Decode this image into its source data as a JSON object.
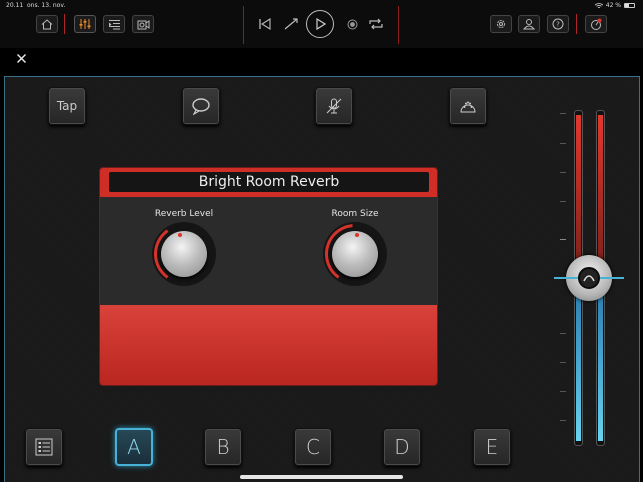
{
  "status": {
    "time": "20.11",
    "date": "ons. 13. nov.",
    "battery": "42 %"
  },
  "toolbar": {
    "left_icons": [
      "home-icon",
      "mixer-icon",
      "list-icon",
      "amp-icon"
    ],
    "transport_icons": [
      "skip-back-icon",
      "automation-icon",
      "play-icon",
      "record-icon",
      "loop-icon"
    ],
    "right_icons": [
      "gear-icon",
      "user-icon",
      "help-icon",
      "tuner-icon"
    ]
  },
  "top_buttons": {
    "tap": "Tap"
  },
  "effect": {
    "title": "Bright Room Reverb",
    "knobs": [
      {
        "label": "Reverb Level"
      },
      {
        "label": "Room Size"
      }
    ],
    "accent": "#cf2e27"
  },
  "bottom_buttons": {
    "a": "A",
    "b": "B",
    "c": "C",
    "d": "D",
    "e": "E"
  },
  "colors": {
    "accent_red": "#cf2e27",
    "selection_blue": "#47b2d6",
    "active_orange": "#e98a2b"
  }
}
